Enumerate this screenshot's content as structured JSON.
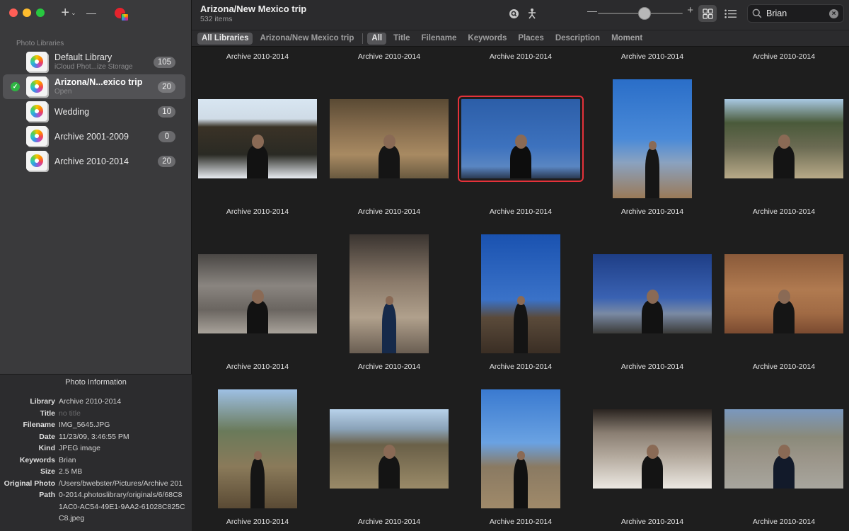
{
  "toolbar": {
    "add_label": "+",
    "add_chevron": "⌄",
    "remove_label": "—",
    "add_icon": "plus-icon",
    "remove_icon": "minus-icon",
    "app_icon": "photos-library-icon"
  },
  "sidebar": {
    "section_title": "Photo Libraries",
    "libraries": [
      {
        "name": "Default Library",
        "subtitle": "iCloud Phot...ize Storage",
        "count": "105",
        "selected": false,
        "open": false
      },
      {
        "name": "Arizona/N...exico trip",
        "subtitle": "Open",
        "count": "20",
        "selected": true,
        "open": true
      },
      {
        "name": "Wedding",
        "subtitle": "",
        "count": "10",
        "selected": false,
        "open": false
      },
      {
        "name": "Archive 2001-2009",
        "subtitle": "",
        "count": "0",
        "selected": false,
        "open": false
      },
      {
        "name": "Archive 2010-2014",
        "subtitle": "",
        "count": "20",
        "selected": false,
        "open": false
      }
    ]
  },
  "info_panel": {
    "title": "Photo Information",
    "rows": [
      {
        "label": "Library",
        "value": "Archive 2010-2014",
        "muted": false
      },
      {
        "label": "Title",
        "value": "no title",
        "muted": true
      },
      {
        "label": "Filename",
        "value": "IMG_5645.JPG",
        "muted": false
      },
      {
        "label": "Date",
        "value": "11/23/09, 3:46:55 PM",
        "muted": false
      },
      {
        "label": "Kind",
        "value": "JPEG image",
        "muted": false
      },
      {
        "label": "Keywords",
        "value": "Brian",
        "muted": false
      },
      {
        "label": "Size",
        "value": "2.5 MB",
        "muted": false
      },
      {
        "label": "Original Photo Path",
        "value": "/Users/bwebster/Pictures/Archive 2010-2014.photoslibrary/originals/6/68C81AC0-AC54-49E1-9AA2-61028C825CC8.jpeg",
        "muted": false
      }
    ]
  },
  "header": {
    "title": "Arizona/New Mexico trip",
    "subtitle": "532 items",
    "zoom_level": 0.55,
    "search_value": "Brian",
    "search_placeholder": "Search",
    "icons": [
      "globe-search-icon",
      "person-share-icon",
      "grid-view-icon",
      "list-view-icon",
      "search-icon",
      "clear-icon"
    ]
  },
  "filters": {
    "scope": [
      {
        "label": "All Libraries",
        "active": true
      },
      {
        "label": "Arizona/New Mexico trip",
        "active": false
      }
    ],
    "fields": [
      {
        "label": "All",
        "active": true
      },
      {
        "label": "Title",
        "active": false
      },
      {
        "label": "Filename",
        "active": false
      },
      {
        "label": "Keywords",
        "active": false
      },
      {
        "label": "Places",
        "active": false
      },
      {
        "label": "Description",
        "active": false
      },
      {
        "label": "Moment",
        "active": false
      }
    ]
  },
  "grid": {
    "top_labels": [
      "Archive 2010-2014",
      "Archive 2010-2014",
      "Archive 2010-2014",
      "Archive 2010-2014",
      "Archive 2010-2014"
    ],
    "rows": [
      [
        {
          "label": "Archive 2010-2014",
          "orient": "landscape",
          "scene": "lava",
          "selected": false
        },
        {
          "label": "Archive 2010-2014",
          "orient": "landscape",
          "scene": "brush",
          "selected": false
        },
        {
          "label": "Archive 2010-2014",
          "orient": "landscape",
          "scene": "sky",
          "selected": true
        },
        {
          "label": "Archive 2010-2014",
          "orient": "portrait",
          "scene": "sky-rock",
          "selected": false
        },
        {
          "label": "Archive 2010-2014",
          "orient": "landscape",
          "scene": "forest",
          "selected": false
        }
      ],
      [
        {
          "label": "Archive 2010-2014",
          "orient": "landscape",
          "scene": "cave",
          "selected": false
        },
        {
          "label": "Archive 2010-2014",
          "orient": "portrait",
          "scene": "cave-door",
          "selected": false
        },
        {
          "label": "Archive 2010-2014",
          "orient": "portrait",
          "scene": "sky-rock-dark",
          "selected": false
        },
        {
          "label": "Archive 2010-2014",
          "orient": "landscape",
          "scene": "towers",
          "selected": false
        },
        {
          "label": "Archive 2010-2014",
          "orient": "landscape",
          "scene": "sign",
          "selected": false
        }
      ],
      [
        {
          "label": "Archive 2010-2014",
          "orient": "portrait",
          "scene": "trees",
          "selected": false
        },
        {
          "label": "Archive 2010-2014",
          "orient": "landscape",
          "scene": "fence",
          "selected": false
        },
        {
          "label": "Archive 2010-2014",
          "orient": "portrait",
          "scene": "hill",
          "selected": false
        },
        {
          "label": "Archive 2010-2014",
          "orient": "landscape",
          "scene": "cave-seat",
          "selected": false
        },
        {
          "label": "Archive 2010-2014",
          "orient": "landscape",
          "scene": "road",
          "selected": false
        }
      ]
    ]
  }
}
